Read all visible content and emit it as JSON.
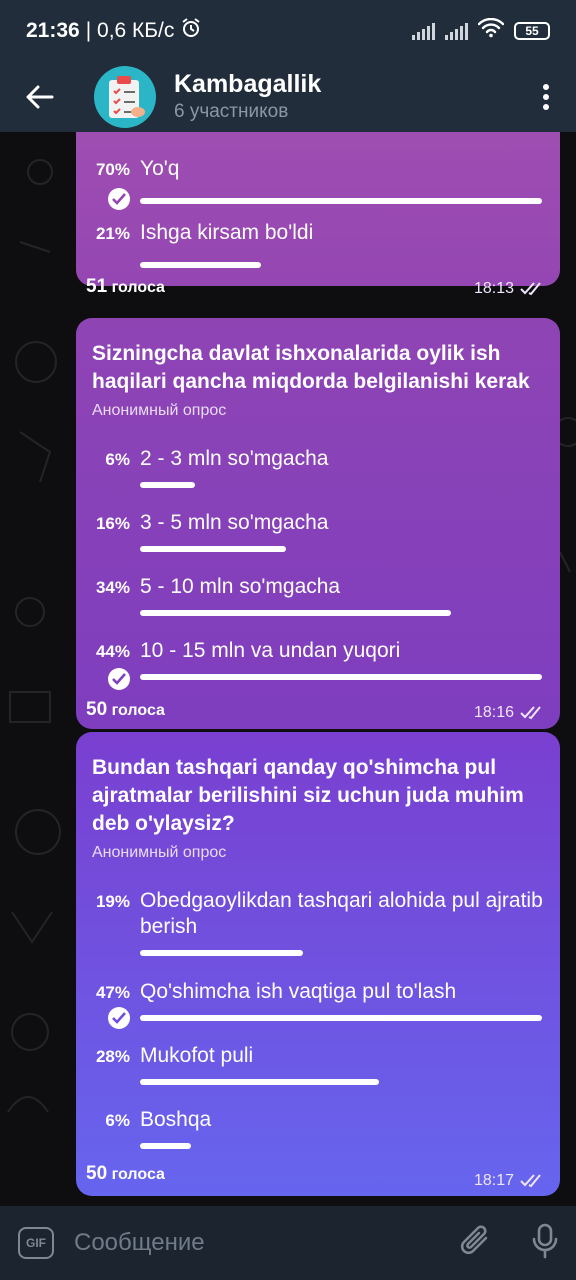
{
  "status": {
    "time": "21:36",
    "speed": "| 0,6 КБ/с",
    "battery": "55"
  },
  "header": {
    "title": "Kambagallik",
    "subtitle": "6 участников"
  },
  "poll1": {
    "options": [
      {
        "pct": "70%",
        "label": "Yo'q",
        "fraction": 0.7,
        "checked": true
      },
      {
        "pct": "21%",
        "label": "Ishga kirsam bo'ldi",
        "fraction": 0.21,
        "checked": false
      }
    ],
    "votes_num": "51",
    "votes_word": "голоса",
    "time": "18:13"
  },
  "poll2": {
    "question": "Sizningcha davlat ishxonalarida oylik ish haqilari qancha miqdorda belgilanishi kerak",
    "type": "Анонимный опрос",
    "options": [
      {
        "pct": "6%",
        "label": "2 - 3 mln so'mgacha",
        "fraction": 0.06,
        "checked": false
      },
      {
        "pct": "16%",
        "label": "3 - 5 mln so'mgacha",
        "fraction": 0.16,
        "checked": false
      },
      {
        "pct": "34%",
        "label": "5 - 10 mln so'mgacha",
        "fraction": 0.34,
        "checked": false
      },
      {
        "pct": "44%",
        "label": "10 - 15 mln va undan yuqori",
        "fraction": 0.44,
        "checked": true
      }
    ],
    "votes_num": "50",
    "votes_word": "голоса",
    "time": "18:16"
  },
  "poll3": {
    "question": "Bundan tashqari qanday qo'shimcha pul ajratmalar berilishini siz uchun juda muhim deb o'ylaysiz?",
    "type": "Анонимный опрос",
    "options": [
      {
        "pct": "19%",
        "label": "Obedgaoylikdan tashqari alohida pul ajratib berish",
        "fraction": 0.19,
        "checked": false
      },
      {
        "pct": "47%",
        "label": "Qo'shimcha ish vaqtiga pul to'lash",
        "fraction": 0.47,
        "checked": true
      },
      {
        "pct": "28%",
        "label": "Mukofot puli",
        "fraction": 0.28,
        "checked": false
      },
      {
        "pct": "6%",
        "label": "Boshqa",
        "fraction": 0.06,
        "checked": false
      }
    ],
    "votes_num": "50",
    "votes_word": "голоса",
    "time": "18:17"
  },
  "input": {
    "gif_label": "GIF",
    "placeholder": "Сообщение"
  },
  "colors": {
    "header_bg": "#212d3b",
    "poll_top": "#a04fb1",
    "poll_bottom": "#6665ef"
  }
}
